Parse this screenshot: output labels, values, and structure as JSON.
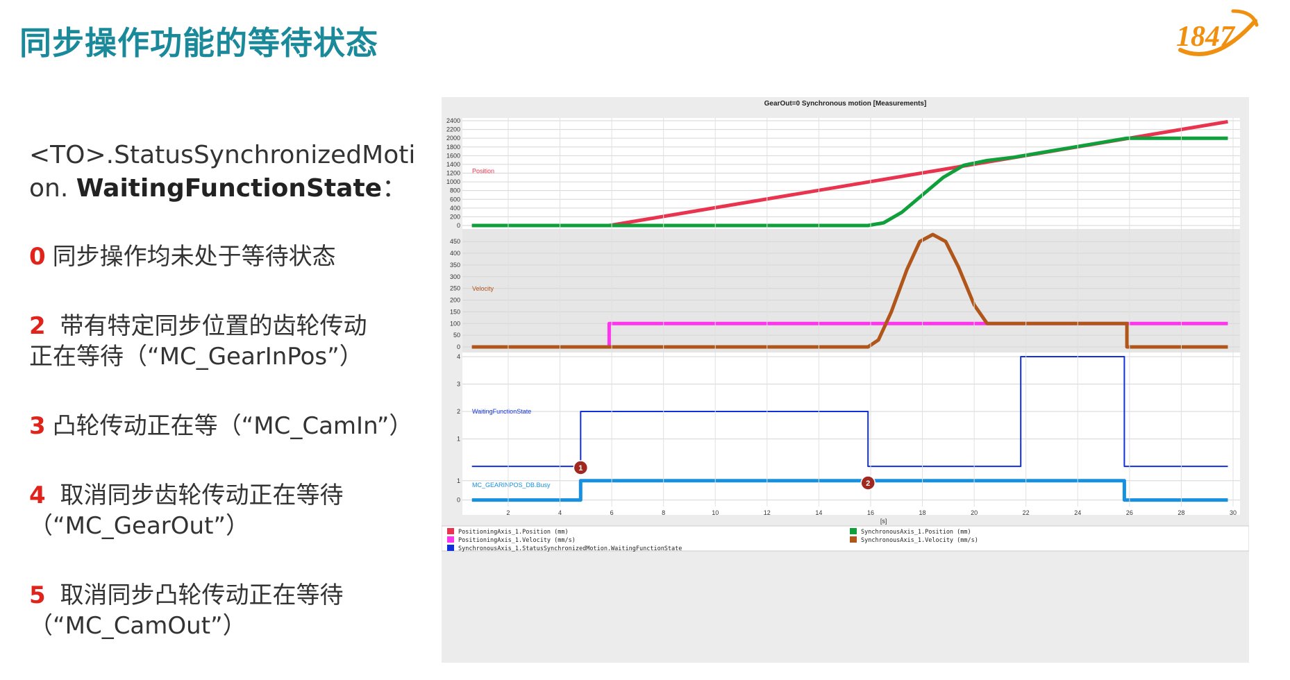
{
  "page": {
    "title": "同步操作功能的等待状态",
    "logo_text": "1847",
    "property_line1": "<TO>.StatusSynchronizedMoti",
    "property_line2_prefix": "on. ",
    "property_line2_bold": "WaitingFunctionState",
    "property_line2_suffix": "：",
    "states": [
      {
        "num": "0",
        "line1": "同步操作均未处于等待状态",
        "line2": ""
      },
      {
        "num": "2",
        "line1": " 带有特定同步位置的齿轮传动",
        "line2": "正在等待（“MC_GearInPos”）"
      },
      {
        "num": "3",
        "line1": "凸轮传动正在等（“MC_CamIn”）",
        "line2": ""
      },
      {
        "num": "4",
        "line1": " 取消同步齿轮传动正在等待",
        "line2": "（“MC_GearOut”）"
      },
      {
        "num": "5",
        "line1": " 取消同步凸轮传动正在等待",
        "line2": "（“MC_CamOut”）"
      }
    ]
  },
  "colors": {
    "title": "#1a8a9a",
    "accent_number": "#e0241b",
    "pos_axis_position": "#e8344e",
    "pos_axis_velocity": "#ff35ee",
    "sync_axis_position": "#0fa03c",
    "sync_axis_velocity": "#b0561a",
    "waiting_state": "#1030e0",
    "busy": "#1890e0",
    "marker": "#a0281e"
  },
  "chart_data": {
    "type": "line",
    "title": "GearOut=0 Synchronous motion [Measurements]",
    "xlabel": "[s]",
    "xlim": [
      0.5,
      30
    ],
    "x_ticks": [
      2,
      4,
      6,
      8,
      10,
      12,
      14,
      16,
      18,
      20,
      22,
      24,
      26,
      28,
      30
    ],
    "panels": [
      {
        "label": "Position",
        "ylim": [
          0,
          2400
        ],
        "y_ticks": [
          0,
          200,
          400,
          600,
          800,
          1000,
          1200,
          1400,
          1600,
          1800,
          2000,
          2200,
          2400
        ],
        "series": [
          {
            "legend": "PositioningAxis_1.Position (mm)",
            "color_key": "pos_axis_position",
            "points": [
              [
                0.6,
                0
              ],
              [
                5.9,
                0
              ],
              [
                29.8,
                2380
              ]
            ]
          },
          {
            "legend": "SynchronousAxis_1.Position (mm)",
            "color_key": "sync_axis_position",
            "points": [
              [
                0.6,
                0
              ],
              [
                15.9,
                0
              ],
              [
                16.5,
                60
              ],
              [
                17.2,
                300
              ],
              [
                18.0,
                700
              ],
              [
                18.8,
                1100
              ],
              [
                19.6,
                1380
              ],
              [
                20.5,
                1490
              ],
              [
                21.5,
                1560
              ],
              [
                25.9,
                2000
              ],
              [
                29.8,
                2000
              ]
            ]
          }
        ]
      },
      {
        "label": "Velocity",
        "ylim": [
          0,
          480
        ],
        "y_ticks": [
          0,
          50,
          100,
          150,
          200,
          250,
          300,
          350,
          400,
          450
        ],
        "series": [
          {
            "legend": "PositioningAxis_1.Velocity (mm/s)",
            "color_key": "pos_axis_velocity",
            "points": [
              [
                0.6,
                0
              ],
              [
                5.9,
                0
              ],
              [
                5.9,
                100
              ],
              [
                29.8,
                100
              ]
            ]
          },
          {
            "legend": "SynchronousAxis_1.Velocity (mm/s)",
            "color_key": "sync_axis_velocity",
            "points": [
              [
                0.6,
                0
              ],
              [
                15.9,
                0
              ],
              [
                16.3,
                30
              ],
              [
                16.8,
                150
              ],
              [
                17.4,
                330
              ],
              [
                17.9,
                450
              ],
              [
                18.4,
                480
              ],
              [
                18.9,
                450
              ],
              [
                19.4,
                340
              ],
              [
                20.0,
                180
              ],
              [
                20.5,
                100
              ],
              [
                25.9,
                100
              ],
              [
                25.9,
                0
              ],
              [
                29.8,
                0
              ]
            ]
          }
        ]
      },
      {
        "label": "WaitingFunctionState",
        "ylim": [
          -0.2,
          4.05
        ],
        "y_ticks": [
          1,
          2,
          3,
          4
        ],
        "series": [
          {
            "legend": "SynchronousAxis_1.StatusSynchronizedMotion.WaitingFunctionState",
            "color_key": "waiting_state",
            "points": [
              [
                0.6,
                0
              ],
              [
                4.8,
                0
              ],
              [
                4.8,
                2
              ],
              [
                15.9,
                2
              ],
              [
                15.9,
                0
              ],
              [
                21.8,
                0
              ],
              [
                21.8,
                4
              ],
              [
                25.8,
                4
              ],
              [
                25.8,
                0
              ],
              [
                29.8,
                0
              ]
            ]
          }
        ]
      },
      {
        "label": "MC_GEARINPOS_DB.Busy",
        "ylim": [
          -0.05,
          1.1
        ],
        "y_ticks": [
          0,
          1
        ],
        "series": [
          {
            "legend": "",
            "color_key": "busy",
            "points": [
              [
                0.6,
                0
              ],
              [
                4.8,
                0
              ],
              [
                4.8,
                1
              ],
              [
                25.8,
                1
              ],
              [
                25.8,
                0
              ],
              [
                29.8,
                0
              ]
            ]
          }
        ]
      }
    ],
    "markers": [
      {
        "label": "1",
        "x": 4.8,
        "panel": 3
      },
      {
        "label": "2",
        "x": 15.9,
        "panel": 2
      }
    ],
    "legend_position": "bottom"
  }
}
